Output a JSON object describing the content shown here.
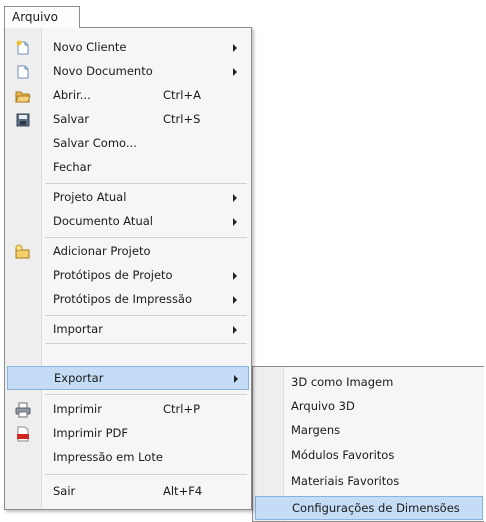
{
  "menubar": {
    "title": "Arquivo"
  },
  "menu": {
    "items": [
      {
        "label": "Novo Cliente",
        "icon": "new-client-icon",
        "submenu": true
      },
      {
        "label": "Novo Documento",
        "icon": "new-document-icon",
        "submenu": true
      },
      {
        "label": "Abrir...",
        "icon": "open-folder-icon",
        "shortcut": "Ctrl+A"
      },
      {
        "label": "Salvar",
        "icon": "save-icon",
        "shortcut": "Ctrl+S"
      },
      {
        "label": "Salvar Como..."
      },
      {
        "label": "Fechar"
      },
      {
        "label": "Projeto Atual",
        "submenu": true
      },
      {
        "label": "Documento Atual",
        "submenu": true
      },
      {
        "label": "Adicionar Projeto",
        "icon": "add-project-icon"
      },
      {
        "label": "Protótipos de Projeto",
        "submenu": true
      },
      {
        "label": "Protótipos de Impressão",
        "submenu": true
      },
      {
        "label": "Importar",
        "submenu": true
      },
      {
        "label": "Exportar",
        "submenu": true,
        "selected": true
      },
      {
        "label": "Imprimir",
        "icon": "printer-icon",
        "shortcut": "Ctrl+P"
      },
      {
        "label": "Imprimir PDF",
        "icon": "pdf-icon"
      },
      {
        "label": "Impressão em Lote"
      },
      {
        "label": "Sair",
        "shortcut": "Alt+F4"
      }
    ]
  },
  "export_submenu": {
    "items": [
      {
        "label": "3D como Imagem"
      },
      {
        "label": "Arquivo 3D"
      },
      {
        "label": "Margens"
      },
      {
        "label": "Módulos Favoritos"
      },
      {
        "label": "Materiais Favoritos"
      },
      {
        "label": "Configurações de Dimensões",
        "selected": true
      }
    ]
  },
  "colors": {
    "highlight_fill": "#c4dcf5",
    "highlight_border": "#86b3e0",
    "menu_background": "#f6f6f6"
  }
}
